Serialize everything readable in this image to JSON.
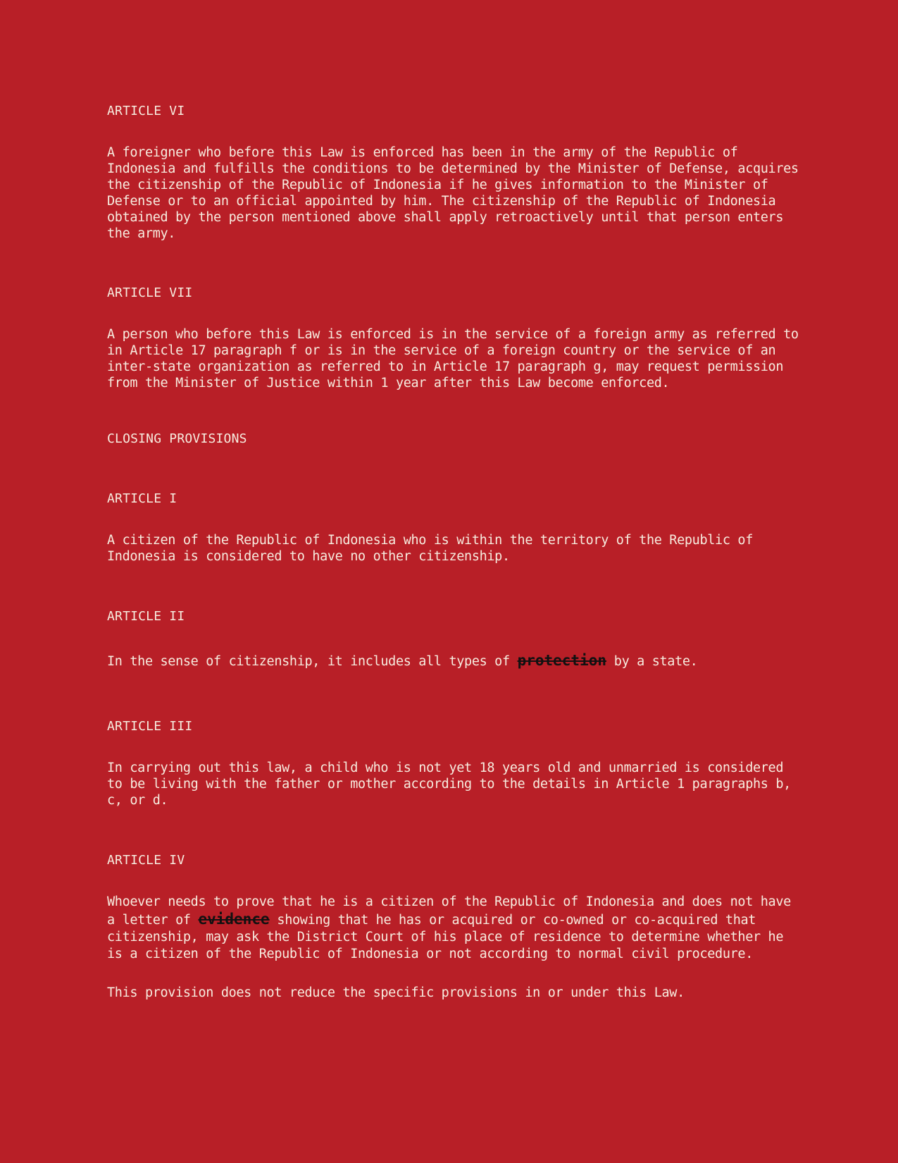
{
  "articles": {
    "vi": {
      "heading": "ARTICLE VI",
      "text": "A foreigner who before this Law is enforced has been in the army of the Republic of Indonesia and fulfills the conditions to be determined by the Minister of Defense, acquires the citizenship of the Republic of Indonesia if he gives information to the Minister of Defense or to an official appointed by him. The citizenship of the Republic of Indonesia obtained by the person mentioned above shall apply retroactively until that person enters the army."
    },
    "vii": {
      "heading": "ARTICLE VII",
      "text": "A person who before this Law is enforced is in the service of a foreign army as referred to in Article 17 paragraph f or is in the service of a foreign country or the service of an inter-state organization as referred to in Article 17 paragraph g, may request permission from the Minister of Justice within 1 year after this Law become enforced."
    }
  },
  "closing": {
    "heading": "CLOSING PROVISIONS",
    "article_i": {
      "heading": "ARTICLE I",
      "text": "A citizen of the Republic of Indonesia who is within the territory of the Republic of Indonesia is considered to have no other citizenship."
    },
    "article_ii": {
      "heading": "ARTICLE II",
      "text_before": "In the sense of citizenship, it includes all types of ",
      "redacted_word": "protection",
      "text_after": " by a state."
    },
    "article_iii": {
      "heading": "ARTICLE III",
      "text": "In carrying out this law, a child who is not yet 18 years old and unmarried is considered to be living with the father or mother according to the details in Article 1 paragraphs b, c, or d."
    },
    "article_iv": {
      "heading": "ARTICLE IV",
      "text_before": "Whoever needs to prove that he is a citizen of the Republic of Indonesia and does not have a letter of ",
      "redacted_word": "evidence",
      "text_after": " showing that he has or acquired or co-owned or co-acquired that citizenship, may ask the District Court of his place of residence to determine whether he is a citizen of the Republic of Indonesia or not according to normal civil procedure.",
      "text_2": "This provision does not reduce the specific provisions in or under this Law."
    }
  }
}
